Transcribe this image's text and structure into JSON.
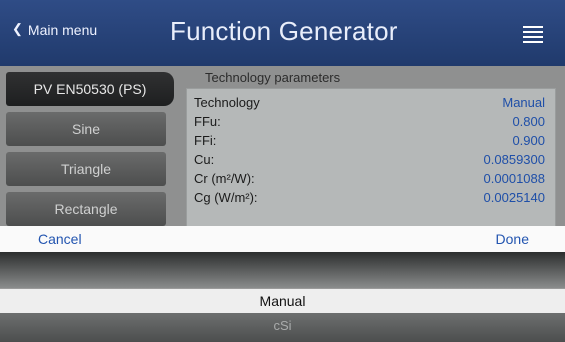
{
  "header": {
    "back_label": "Main menu",
    "title": "Function Generator",
    "menu_icon": "hamburger-menu-icon"
  },
  "sidebar": {
    "items": [
      {
        "label": "PV EN50530 (PS)",
        "active": true
      },
      {
        "label": "Sine",
        "active": false
      },
      {
        "label": "Triangle",
        "active": false
      },
      {
        "label": "Rectangle",
        "active": false
      }
    ]
  },
  "tech_params": {
    "label": "Technology parameters",
    "rows": [
      {
        "key": "Technology",
        "value": "Manual"
      },
      {
        "key": "FFu:",
        "value": "0.800"
      },
      {
        "key": "FFi:",
        "value": "0.900"
      },
      {
        "key": "Cu:",
        "value": "0.0859300"
      },
      {
        "key": "Cr (m²/W):",
        "value": "0.0001088"
      },
      {
        "key": "Cg (W/m²):",
        "value": "0.0025140"
      }
    ]
  },
  "picker": {
    "cancel_label": "Cancel",
    "done_label": "Done",
    "selected": "Manual",
    "next": "cSi"
  },
  "colors": {
    "header_bg": "#2a467d",
    "value_text": "#1f4fa8",
    "picker_action": "#2355b0"
  }
}
